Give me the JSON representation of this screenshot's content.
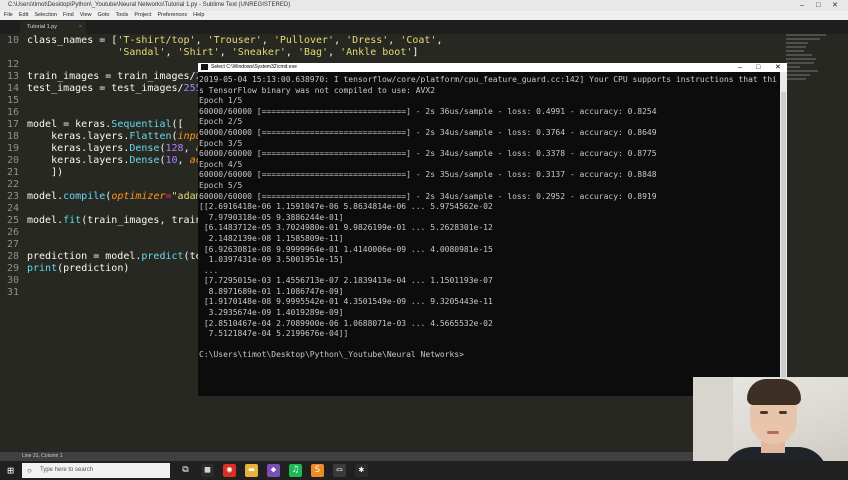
{
  "window": {
    "title": "C:\\Users\\timot\\Desktop\\Python\\_Youtube\\Neural Networks\\Tutorial 1.py - Sublime Text (UNREGISTERED)",
    "controls": [
      "–",
      "□",
      "✕"
    ]
  },
  "menu": [
    "File",
    "Edit",
    "Selection",
    "Find",
    "View",
    "Goto",
    "Tools",
    "Project",
    "Preferences",
    "Help"
  ],
  "tab": {
    "label": "Tutorial 1.py",
    "close": "×"
  },
  "editor": {
    "lines": [
      {
        "n": "10",
        "segments": [
          [
            "class_names = [",
            ""
          ],
          [
            "'T-shirt/top'",
            "s"
          ],
          [
            ", ",
            ""
          ],
          [
            "'Trouser'",
            "s"
          ],
          [
            ", ",
            ""
          ],
          [
            "'Pullover'",
            "s"
          ],
          [
            ", ",
            ""
          ],
          [
            "'Dress'",
            "s"
          ],
          [
            ", ",
            ""
          ],
          [
            "'Coat'",
            "s"
          ],
          [
            ",",
            ""
          ]
        ]
      },
      {
        "n": "",
        "segments": [
          [
            "               ",
            ""
          ],
          [
            "'Sandal'",
            "s"
          ],
          [
            ", ",
            ""
          ],
          [
            "'Shirt'",
            "s"
          ],
          [
            ", ",
            ""
          ],
          [
            "'Sneaker'",
            "s"
          ],
          [
            ", ",
            ""
          ],
          [
            "'Bag'",
            "s"
          ],
          [
            ", ",
            ""
          ],
          [
            "'Ankle boot'",
            "s"
          ],
          [
            "]",
            ""
          ]
        ]
      },
      {
        "n": "12",
        "segments": []
      },
      {
        "n": "13",
        "segments": [
          [
            "train_images = train_images/",
            ""
          ],
          [
            "255",
            "n"
          ]
        ]
      },
      {
        "n": "14",
        "segments": [
          [
            "test_images = test_images/",
            ""
          ],
          [
            "255.",
            "n"
          ]
        ]
      },
      {
        "n": "15",
        "segments": []
      },
      {
        "n": "16",
        "segments": []
      },
      {
        "n": "17",
        "segments": [
          [
            "model = keras.",
            ""
          ],
          [
            "Sequential",
            "f"
          ],
          [
            "([",
            ""
          ]
        ]
      },
      {
        "n": "18",
        "segments": [
          [
            "    keras.layers.",
            ""
          ],
          [
            "Flatten",
            "f"
          ],
          [
            "(",
            ""
          ],
          [
            "input",
            "a"
          ]
        ]
      },
      {
        "n": "19",
        "segments": [
          [
            "    keras.layers.",
            ""
          ],
          [
            "Dense",
            "f"
          ],
          [
            "(",
            ""
          ],
          [
            "128",
            "n"
          ],
          [
            ", ",
            ""
          ],
          [
            "act",
            "a"
          ]
        ]
      },
      {
        "n": "20",
        "segments": [
          [
            "    keras.layers.",
            ""
          ],
          [
            "Dense",
            "f"
          ],
          [
            "(",
            ""
          ],
          [
            "10",
            "n"
          ],
          [
            ", ",
            ""
          ],
          [
            "act",
            "a"
          ]
        ]
      },
      {
        "n": "21",
        "segments": [
          [
            "    ])",
            ""
          ]
        ]
      },
      {
        "n": "22",
        "segments": []
      },
      {
        "n": "23",
        "segments": [
          [
            "model.",
            ""
          ],
          [
            "compile",
            "f"
          ],
          [
            "(",
            ""
          ],
          [
            "optimizer",
            "a"
          ],
          [
            "=",
            "o"
          ],
          [
            "\"adam\"",
            "s"
          ]
        ]
      },
      {
        "n": "24",
        "segments": []
      },
      {
        "n": "25",
        "segments": [
          [
            "model.",
            ""
          ],
          [
            "fit",
            "f"
          ],
          [
            "(train_images, train_",
            ""
          ]
        ]
      },
      {
        "n": "26",
        "segments": []
      },
      {
        "n": "27",
        "segments": []
      },
      {
        "n": "28",
        "segments": [
          [
            "prediction = model.",
            ""
          ],
          [
            "predict",
            "f"
          ],
          [
            "(test",
            ""
          ]
        ]
      },
      {
        "n": "29",
        "segments": [
          [
            "print",
            "f"
          ],
          [
            "(prediction)",
            ""
          ]
        ]
      },
      {
        "n": "30",
        "segments": []
      },
      {
        "n": "31",
        "segments": []
      }
    ]
  },
  "status": "Line 31, Column 1",
  "cmd": {
    "title": "Select C:\\Windows\\System32\\cmd.exe",
    "controls": [
      "–",
      "□",
      "✕"
    ],
    "output": [
      "2019-05-04 15:13:00.638970: I tensorflow/core/platform/cpu_feature_guard.cc:142] Your CPU supports instructions that thi",
      "s TensorFlow binary was not compiled to use: AVX2",
      "Epoch 1/5",
      "60000/60000 [==============================] - 2s 36us/sample - loss: 0.4991 - accuracy: 0.8254",
      "Epoch 2/5",
      "60000/60000 [==============================] - 2s 34us/sample - loss: 0.3764 - accuracy: 0.8649",
      "Epoch 3/5",
      "60000/60000 [==============================] - 2s 34us/sample - loss: 0.3378 - accuracy: 0.8775",
      "Epoch 4/5",
      "60000/60000 [==============================] - 2s 35us/sample - loss: 0.3137 - accuracy: 0.8848",
      "Epoch 5/5",
      "60000/60000 [==============================] - 2s 34us/sample - loss: 0.2952 - accuracy: 0.8919",
      "[[2.6916418e-06 1.1591047e-06 5.8634814e-06 ... 5.9754562e-02",
      "  7.9790318e-05 9.3886244e-01]",
      " [6.1483712e-05 3.7024980e-01 9.9826199e-01 ... 5.2628301e-12",
      "  2.1482139e-08 1.1585809e-11]",
      " [6.9263081e-08 9.9999964e-01 1.4140006e-09 ... 4.0080981e-15",
      "  1.0397431e-09 3.5001951e-15]",
      " ...",
      " [7.7295015e-03 1.4556713e-07 2.1839413e-04 ... 1.1501193e-07",
      "  8.8971689e-01 1.1086747e-09]",
      " [1.9170148e-08 9.9995542e-01 4.3501549e-09 ... 9.3205443e-11",
      "  3.2935674e-09 1.4019289e-09]",
      " [2.8510467e-04 2.7089900e-06 1.0688071e-03 ... 4.5665532e-02",
      "  7.5121847e-04 5.2199676e-04]]",
      "",
      "C:\\Users\\timot\\Desktop\\Python\\_Youtube\\Neural Networks>"
    ]
  },
  "taskbar": {
    "search_placeholder": "Type here to search",
    "icons": [
      {
        "name": "task-view-icon",
        "glyph": "⧉",
        "color": "#202020"
      },
      {
        "name": "store-icon",
        "glyph": "▦",
        "color": "#2b2b2b"
      },
      {
        "name": "chrome-icon",
        "glyph": "◉",
        "color": "#d93025"
      },
      {
        "name": "file-explorer-icon",
        "glyph": "▬",
        "color": "#e8b33c"
      },
      {
        "name": "visual-studio-icon",
        "glyph": "◆",
        "color": "#7b4fb8"
      },
      {
        "name": "spotify-icon",
        "glyph": "♫",
        "color": "#1db954"
      },
      {
        "name": "sublime-icon",
        "glyph": "S",
        "color": "#f08a24"
      },
      {
        "name": "cmd-icon",
        "glyph": "▭",
        "color": "#3a3a3a"
      },
      {
        "name": "app-icon",
        "glyph": "✱",
        "color": "#2b2b2b"
      }
    ]
  },
  "colors": {
    "editor_bg": "#272822",
    "string": "#e6db74",
    "function": "#66d9ef",
    "number": "#ae81ff",
    "keyword_arg": "#fd971f"
  }
}
